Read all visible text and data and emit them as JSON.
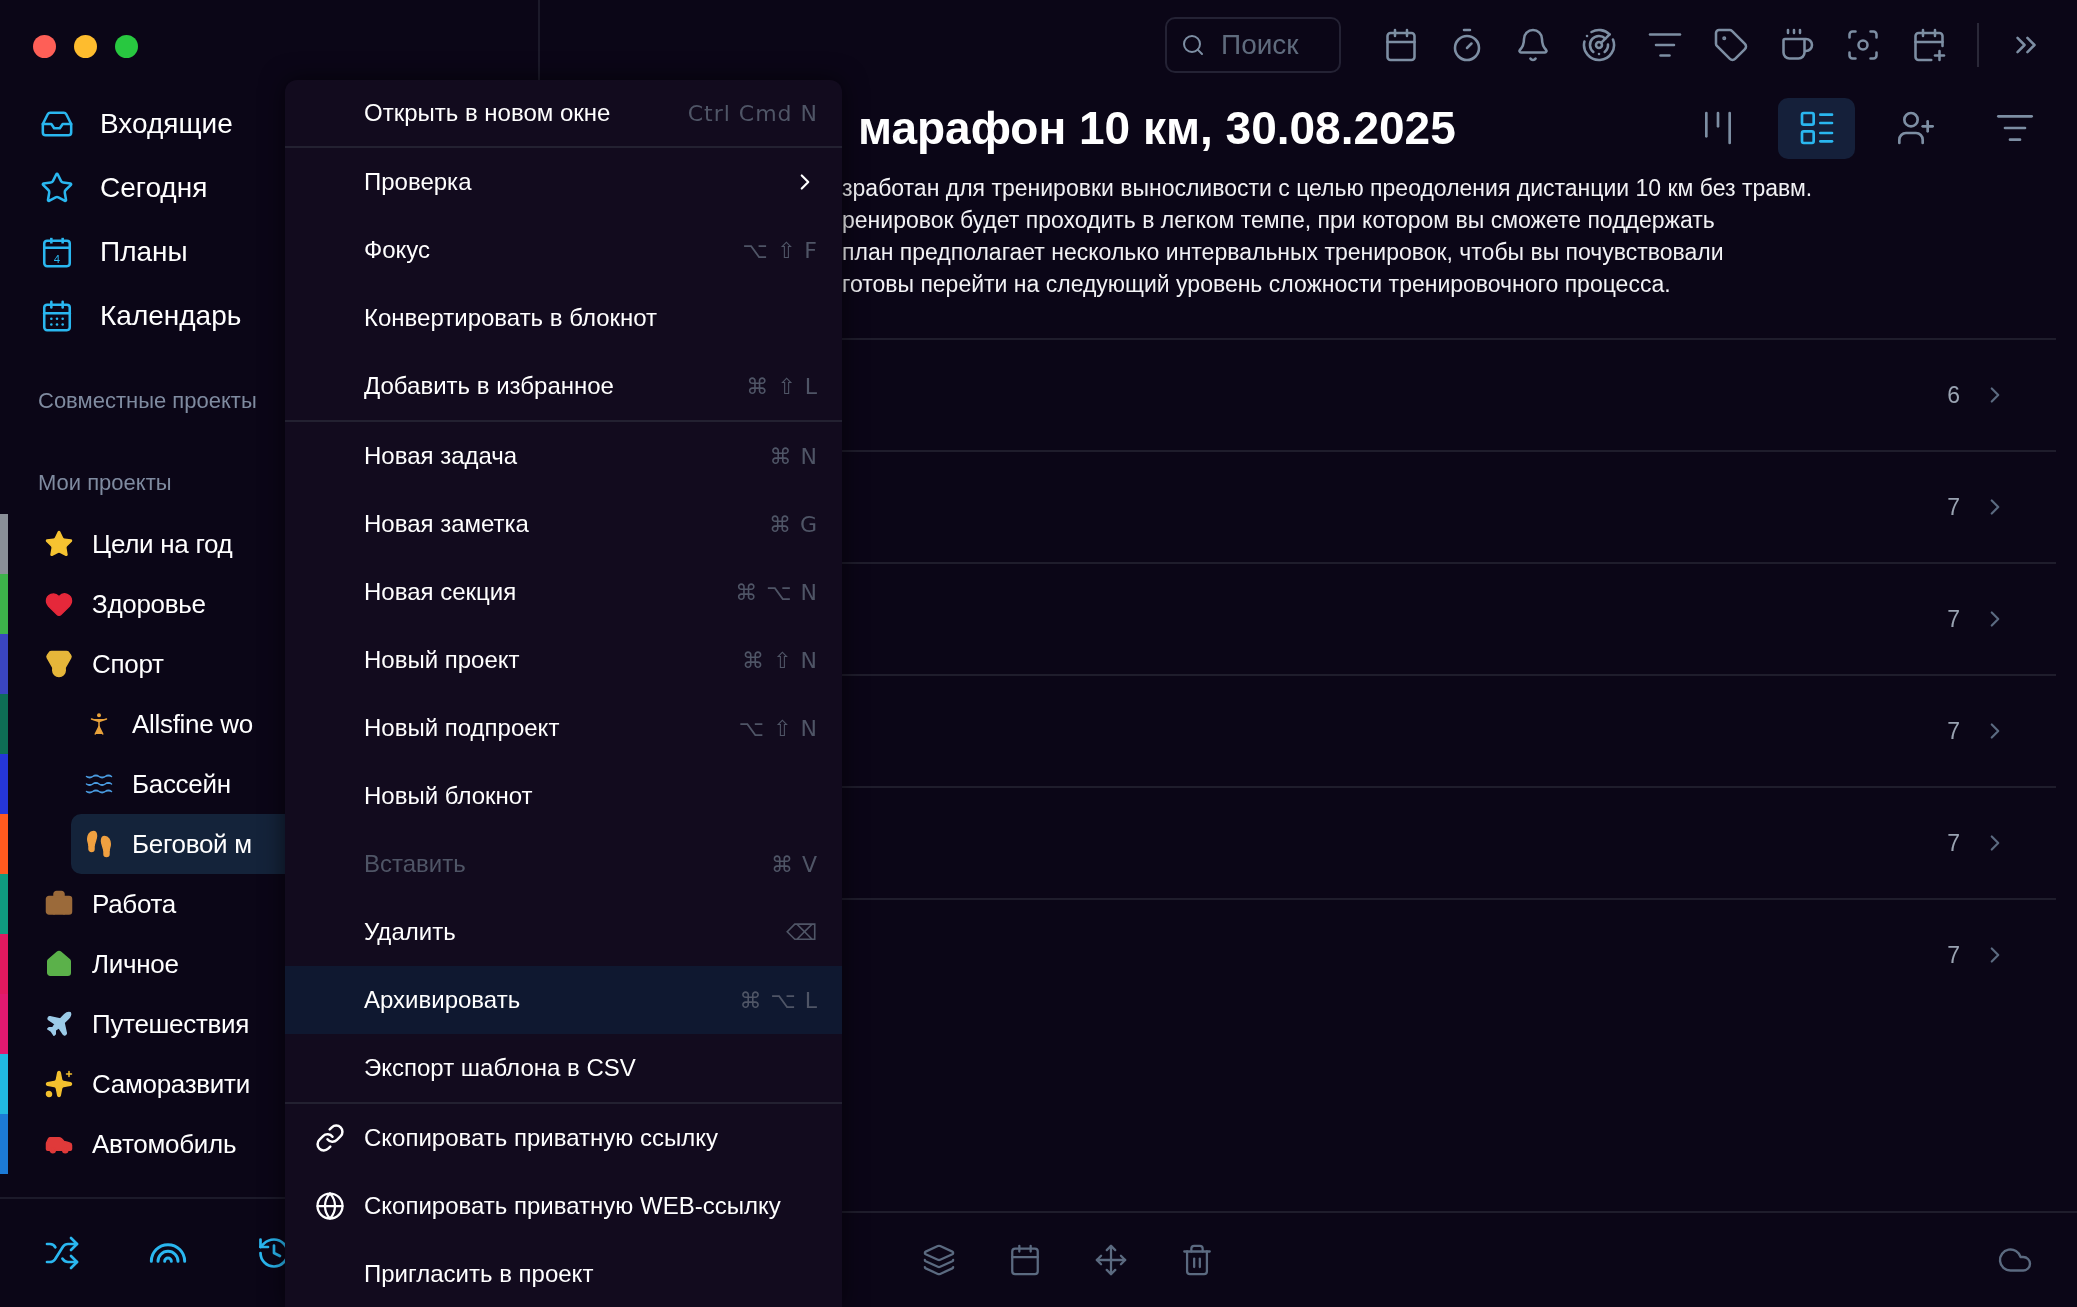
{
  "sidebar": {
    "nav": [
      {
        "label": "Входящие"
      },
      {
        "label": "Сегодня"
      },
      {
        "label": "Планы",
        "icon_text": "4"
      },
      {
        "label": "Календарь"
      }
    ],
    "shared_header": "Совместные проекты",
    "projects_header": "Мои проекты",
    "projects": [
      {
        "label": "Цели на год",
        "color": "#8a8f98",
        "selected": false
      },
      {
        "label": "Здоровье",
        "color": "#3db24a",
        "selected": false
      },
      {
        "label": "Спорт",
        "color": "#3a45c0",
        "selected": false,
        "children": [
          {
            "label": "Allsfine wo",
            "color": "#0e6e55",
            "selected": false
          },
          {
            "label": "Бассейн",
            "color": "#2536d9",
            "selected": false
          },
          {
            "label": "Беговой м",
            "color": "#ff5a1f",
            "selected": true
          }
        ]
      },
      {
        "label": "Работа",
        "color": "#0f9b7f",
        "selected": false
      },
      {
        "label": "Личное",
        "color": "#e0195f",
        "selected": false
      },
      {
        "label": "Путешествия",
        "color": "#e0196f",
        "selected": false
      },
      {
        "label": "Саморазвити",
        "color": "#21b8e0",
        "selected": false
      },
      {
        "label": "Автомобиль",
        "color": "#1c7ad6",
        "selected": false
      }
    ]
  },
  "toolbar": {
    "search": {
      "placeholder": "Поиск"
    }
  },
  "title": "марафон 10 км, 30.08.2025",
  "views": [
    {
      "selected": false
    },
    {
      "selected": true
    },
    {
      "selected": false
    },
    {
      "selected": false
    }
  ],
  "description_lines": [
    "зработан для тренировки выносливости с целью преодоления дистанции 10 км без травм.",
    "ренировок будет проходить в легком темпе, при котором вы сможете поддержать",
    "план предполагает несколько интервальных тренировок, чтобы вы почувствовали",
    "готовы перейти на следующий уровень сложности тренировочного процесса."
  ],
  "sections": [
    {
      "count": "6"
    },
    {
      "count": "7"
    },
    {
      "count": "7"
    },
    {
      "count": "7"
    },
    {
      "count": "7"
    },
    {
      "count": "7"
    }
  ],
  "menu": {
    "groups": [
      {
        "items": [
          {
            "label": "Открыть в новом окне",
            "shortcut": "Ctrl Cmd N",
            "kind": "plain",
            "disabled": false,
            "selected": false
          }
        ]
      },
      {
        "items": [
          {
            "label": "Проверка",
            "kind": "submenu",
            "disabled": false,
            "selected": false
          },
          {
            "label": "Фокус",
            "shortcut": "⌥ ⇧ F",
            "kind": "plain",
            "disabled": false,
            "selected": false
          },
          {
            "label": "Конвертировать в блокнот",
            "kind": "plain",
            "disabled": false,
            "selected": false
          },
          {
            "label": "Добавить в избранное",
            "shortcut": "⌘ ⇧ L",
            "kind": "plain",
            "disabled": false,
            "selected": false
          }
        ]
      },
      {
        "items": [
          {
            "label": "Новая задача",
            "shortcut": "⌘ N",
            "kind": "plain",
            "disabled": false,
            "selected": false
          },
          {
            "label": "Новая заметка",
            "shortcut": "⌘ G",
            "kind": "plain",
            "disabled": false,
            "selected": false
          },
          {
            "label": "Новая секция",
            "shortcut": "⌘ ⌥ N",
            "kind": "plain",
            "disabled": false,
            "selected": false
          },
          {
            "label": "Новый проект",
            "shortcut": "⌘ ⇧ N",
            "kind": "plain",
            "disabled": false,
            "selected": false
          },
          {
            "label": "Новый подпроект",
            "shortcut": "⌥ ⇧ N",
            "kind": "plain",
            "disabled": false,
            "selected": false
          },
          {
            "label": "Новый блокнот",
            "kind": "plain",
            "disabled": false,
            "selected": false
          },
          {
            "label": "Вставить",
            "shortcut": "⌘ V",
            "kind": "plain",
            "disabled": true,
            "selected": false
          },
          {
            "label": "Удалить",
            "shortcut": "⌫",
            "kind": "plain",
            "disabled": false,
            "selected": false
          },
          {
            "label": "Архивировать",
            "shortcut": "⌘ ⌥ L",
            "kind": "plain",
            "disabled": false,
            "selected": true
          },
          {
            "label": "Экспорт шаблона в CSV",
            "kind": "plain",
            "disabled": false,
            "selected": false
          }
        ]
      },
      {
        "items": [
          {
            "label": "Скопировать приватную ссылку",
            "kind": "link",
            "disabled": false,
            "selected": false
          },
          {
            "label": "Скопировать приватную WEB-ссылку",
            "kind": "globe",
            "disabled": false,
            "selected": false
          },
          {
            "label": "Пригласить в проект",
            "kind": "plain",
            "disabled": false,
            "selected": false
          }
        ]
      }
    ]
  }
}
